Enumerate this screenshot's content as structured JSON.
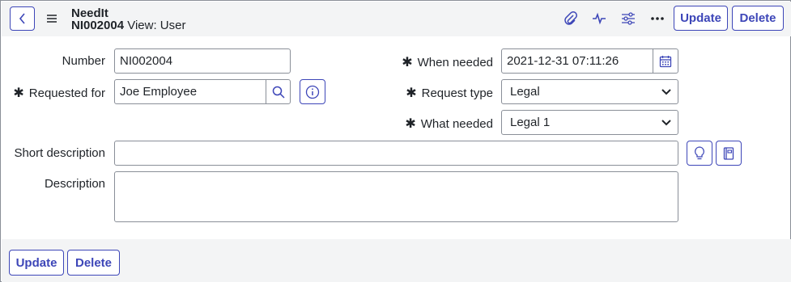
{
  "header": {
    "app_name": "NeedIt",
    "record_number": "NI002004",
    "view_label": "View: User",
    "update_label": "Update",
    "delete_label": "Delete"
  },
  "form": {
    "number": {
      "label": "Number",
      "value": "NI002004"
    },
    "requested_for": {
      "label": "Requested for",
      "value": "Joe Employee"
    },
    "when_needed": {
      "label": "When needed",
      "value": "2021-12-31 07:11:26"
    },
    "request_type": {
      "label": "Request type",
      "value": "Legal"
    },
    "what_needed": {
      "label": "What needed",
      "value": "Legal 1"
    },
    "short_description": {
      "label": "Short description",
      "value": ""
    },
    "description": {
      "label": "Description",
      "value": ""
    },
    "required_marker": "✱"
  },
  "footer": {
    "update_label": "Update",
    "delete_label": "Delete"
  },
  "colors": {
    "accent": "#3d46b8",
    "header_bg": "#f3f4f5",
    "border": "#8a8f98"
  },
  "icons": [
    "back-icon",
    "menu-icon",
    "attachment-icon",
    "activity-icon",
    "settings-icon",
    "more-icon",
    "search-icon",
    "info-icon",
    "calendar-icon",
    "lightbulb-icon",
    "book-icon",
    "chevron-down-icon"
  ]
}
